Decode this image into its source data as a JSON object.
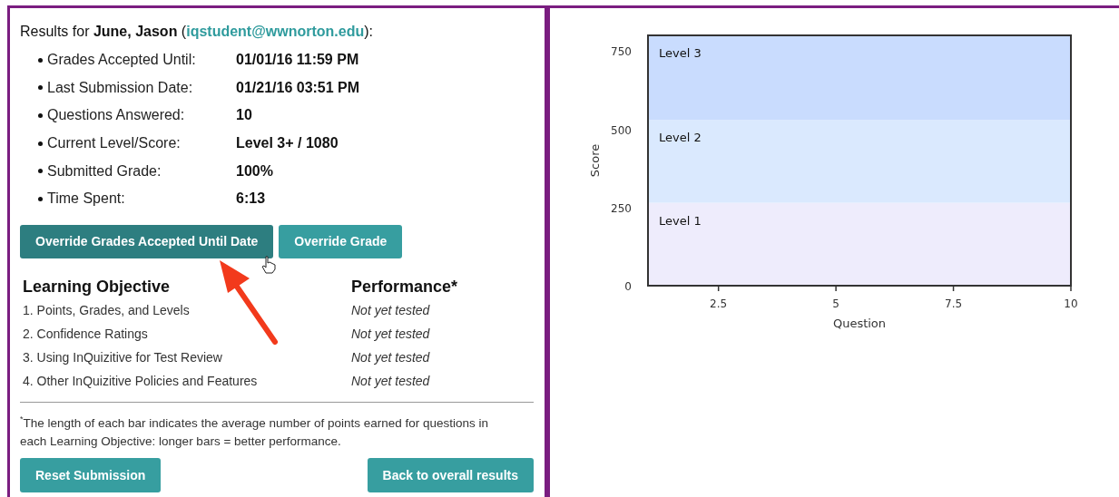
{
  "results_heading": {
    "before": "Results for **June, Jason** (",
    "email": "iqstudent@wwnorton.edu",
    "after": "):"
  },
  "details": [
    {
      "label": "Grades Accepted Until:",
      "value": "01/01/16 11:59 PM"
    },
    {
      "label": "Last Submission Date:",
      "value": "01/21/16 03:51 PM"
    },
    {
      "label": "Questions Answered:",
      "value": "10"
    },
    {
      "label": "Current Level/Score:",
      "value": "Level 3+ / 1080"
    },
    {
      "label": "Submitted Grade:",
      "value": "100%"
    },
    {
      "label": "Time Spent:",
      "value": "6:13"
    }
  ],
  "override_buttons": [
    {
      "label": "Override Grades Accepted Until Date",
      "hovered": true
    },
    {
      "label": "Override Grade",
      "hovered": false
    }
  ],
  "objectives_table": {
    "columns": [
      "Learning Objective",
      "Performance*"
    ],
    "rows": [
      {
        "objective": "1. Points, Grades, and Levels",
        "performance": "Not yet tested"
      },
      {
        "objective": "2. Confidence Ratings",
        "performance": "Not yet tested"
      },
      {
        "objective": "3. Using InQuizitive for Test Review",
        "performance": "Not yet tested"
      },
      {
        "objective": "4. Other InQuizitive Policies and Features",
        "performance": "Not yet tested"
      }
    ]
  },
  "footnote": "$^{*}$The length of each bar indicates the average number of points earned for questions in each Learning Objective: longer bars = better performance.",
  "bottom_buttons": [
    {
      "label": "Reset Submission"
    },
    {
      "label": "Back to overall results"
    }
  ],
  "chart": {
    "chart_data": {
      "type": "line",
      "xlabel": "Question",
      "ylabel": "Score",
      "xlim": [
        1,
        10
      ],
      "ylim": [
        0,
        800
      ],
      "xticks": [
        2.5,
        5,
        7.5,
        10
      ],
      "yticks": [
        0,
        250,
        500,
        750
      ],
      "bands": [
        {
          "axis": "y",
          "label": "Level 1",
          "from": 0,
          "to": 265,
          "color": "#eeecfc"
        },
        {
          "axis": "y",
          "label": "Level 2",
          "from": 265,
          "to": 530,
          "color": "#dae9fe"
        },
        {
          "axis": "y",
          "label": "Level 3",
          "from": 530,
          "to": 800,
          "color": "#c9dcfe"
        }
      ]
    }
  }
}
